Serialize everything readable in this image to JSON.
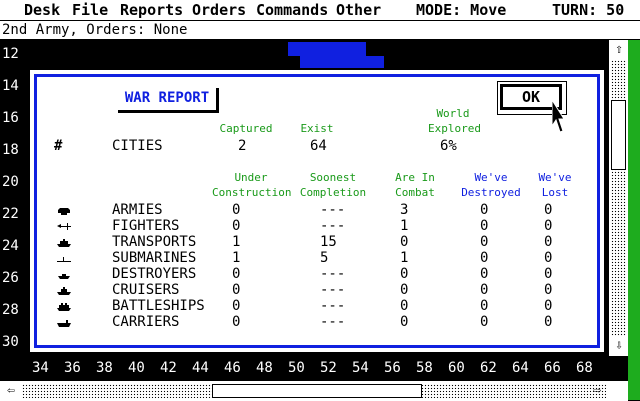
{
  "menu": [
    "Desk",
    "File",
    "Reports",
    "Orders",
    "Commands",
    "Other"
  ],
  "mode_text": "MODE: Move",
  "turn_text": "TURN: 50",
  "info_text": "2nd Army, Orders: None",
  "row_labels": [
    "12",
    "14",
    "16",
    "18",
    "20",
    "22",
    "24",
    "26",
    "28",
    "30"
  ],
  "col_labels": [
    "34",
    "36",
    "38",
    "40",
    "42",
    "44",
    "46",
    "48",
    "50",
    "52",
    "54",
    "56",
    "58",
    "60",
    "62",
    "64",
    "66",
    "68"
  ],
  "scroll": {
    "up": "⇧",
    "down": "⇩",
    "left": "⇦",
    "right": "⇨"
  },
  "dialog": {
    "title": "WAR REPORT",
    "ok": "OK",
    "cities_symbol": "#",
    "cities_label": "CITIES",
    "captured_header": "Captured",
    "exist_header": "Exist",
    "world_header": "World Explored",
    "captured_value": "2",
    "exist_value": "64",
    "explored_value": "6%",
    "headers": {
      "under": "Under Construction",
      "soonest": "Soonest Completion",
      "combat": "Are In Combat",
      "destroyed": "We've Destroyed",
      "lost": "We've Lost"
    },
    "units": [
      {
        "icon": "army-icon",
        "name": "ARMIES",
        "under": "0",
        "soonest": "---",
        "combat": "3",
        "destroyed": "0",
        "lost": "0"
      },
      {
        "icon": "fighter-icon",
        "name": "FIGHTERS",
        "under": "0",
        "soonest": "---",
        "combat": "1",
        "destroyed": "0",
        "lost": "0"
      },
      {
        "icon": "transport-icon",
        "name": "TRANSPORTS",
        "under": "1",
        "soonest": "15",
        "combat": "0",
        "destroyed": "0",
        "lost": "0"
      },
      {
        "icon": "submarine-icon",
        "name": "SUBMARINES",
        "under": "1",
        "soonest": "5",
        "combat": "1",
        "destroyed": "0",
        "lost": "0"
      },
      {
        "icon": "destroyer-icon",
        "name": "DESTROYERS",
        "under": "0",
        "soonest": "---",
        "combat": "0",
        "destroyed": "0",
        "lost": "0"
      },
      {
        "icon": "cruiser-icon",
        "name": "CRUISERS",
        "under": "0",
        "soonest": "---",
        "combat": "0",
        "destroyed": "0",
        "lost": "0"
      },
      {
        "icon": "battleship-icon",
        "name": "BATTLESHIPS",
        "under": "0",
        "soonest": "---",
        "combat": "0",
        "destroyed": "0",
        "lost": "0"
      },
      {
        "icon": "carrier-icon",
        "name": "CARRIERS",
        "under": "0",
        "soonest": "---",
        "combat": "0",
        "destroyed": "0",
        "lost": "0"
      }
    ]
  },
  "colors": {
    "water": "#1020e0",
    "green_text": "#1a9a1a",
    "blue_text": "#1020e0",
    "side_bar": "#1eac1e"
  }
}
